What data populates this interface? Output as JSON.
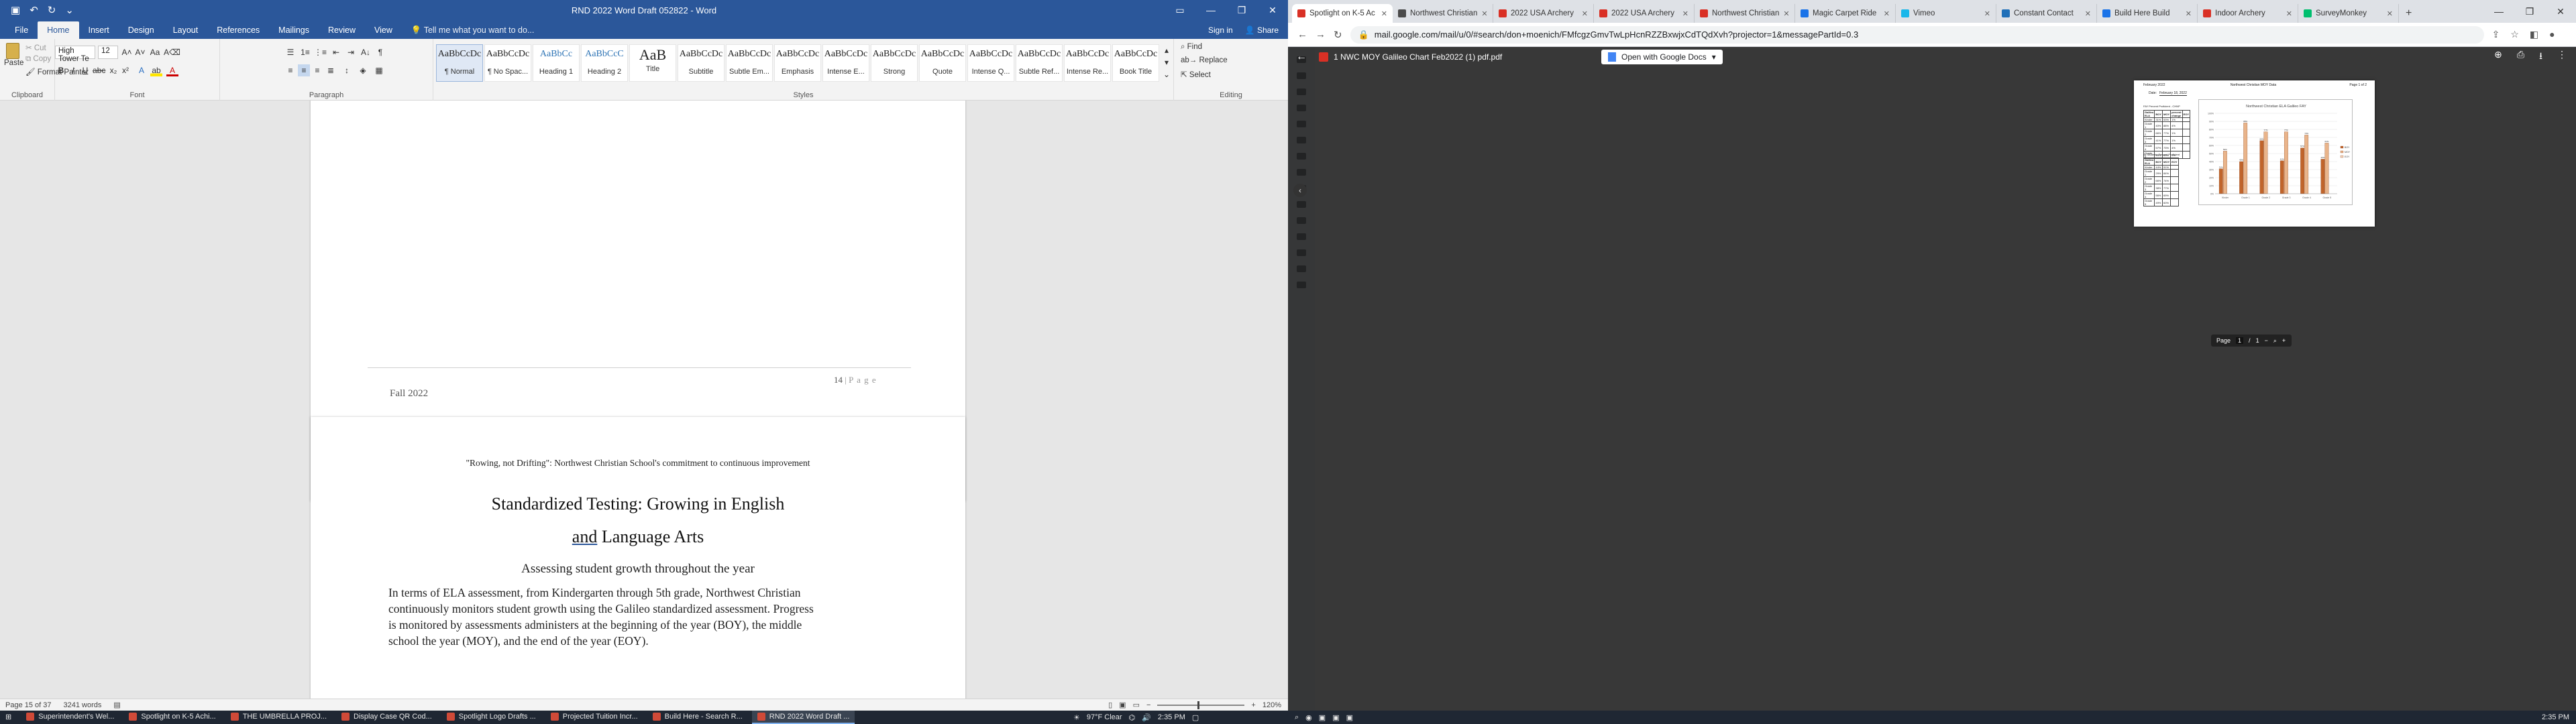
{
  "word": {
    "window_title": "RND 2022 Word Draft 052822 - Word",
    "sign_in": "Sign in",
    "share": "Share",
    "tabs": [
      "File",
      "Home",
      "Insert",
      "Design",
      "Layout",
      "References",
      "Mailings",
      "Review",
      "View"
    ],
    "active_tab": "Home",
    "tell_me": "Tell me what you want to do...",
    "ribbon": {
      "clipboard": {
        "label": "Clipboard",
        "paste": "Paste",
        "cut": "Cut",
        "copy": "Copy",
        "format_painter": "Format Painter"
      },
      "font": {
        "label": "Font",
        "font_name": "High Tower Te",
        "font_size": "12"
      },
      "paragraph": {
        "label": "Paragraph"
      },
      "styles": {
        "label": "Styles",
        "items": [
          {
            "preview": "AaBbCcDc",
            "name": "¶ Normal"
          },
          {
            "preview": "AaBbCcDc",
            "name": "¶ No Spac..."
          },
          {
            "preview": "AaBbCc",
            "name": "Heading 1"
          },
          {
            "preview": "AaBbCcC",
            "name": "Heading 2"
          },
          {
            "preview": "AaB",
            "name": "Title"
          },
          {
            "preview": "AaBbCcDc",
            "name": "Subtitle"
          },
          {
            "preview": "AaBbCcDc",
            "name": "Subtle Em..."
          },
          {
            "preview": "AaBbCcDc",
            "name": "Emphasis"
          },
          {
            "preview": "AaBbCcDc",
            "name": "Intense E..."
          },
          {
            "preview": "AaBbCcDc",
            "name": "Strong"
          },
          {
            "preview": "AaBbCcDc",
            "name": "Quote"
          },
          {
            "preview": "AaBbCcDc",
            "name": "Intense Q..."
          },
          {
            "preview": "AaBbCcDc",
            "name": "Subtle Ref..."
          },
          {
            "preview": "AaBbCcDc",
            "name": "Intense Re..."
          },
          {
            "preview": "AaBbCcDc",
            "name": "Book Title"
          }
        ]
      },
      "editing": {
        "label": "Editing",
        "find": "Find",
        "replace": "Replace",
        "select": "Select"
      }
    },
    "page1": {
      "footer_left": "Fall 2022",
      "page_number": "14",
      "page_word": "P a g e"
    },
    "page2": {
      "tagline": "\"Rowing, not Drifting\":  Northwest Christian School's commitment to continuous improvement",
      "title_line1": "Standardized Testing:  Growing in English",
      "title_line2_a": "and",
      "title_line2_b": " Language Arts",
      "subtitle": "Assessing student growth throughout the year",
      "body": [
        "In terms of ELA assessment, from Kindergarten through 5th grade, Northwest Christian",
        "continuously monitors student growth using the Galileo standardized assessment.  Progress",
        "is monitored by assessments administers at the beginning of the year (BOY), the middle",
        "school the year (MOY), and the end of the year (EOY)."
      ]
    },
    "status": {
      "page": "Page 15 of 37",
      "words": "3241 words",
      "zoom": "120%"
    }
  },
  "chrome": {
    "tabs": [
      {
        "title": "Spotlight on K-5 Ac",
        "active": true,
        "color": "#d93025"
      },
      {
        "title": "Northwest Christian",
        "active": false,
        "color": "#4a4a4a"
      },
      {
        "title": "2022 USA Archery",
        "active": false,
        "color": "#d93025"
      },
      {
        "title": "2022 USA Archery",
        "active": false,
        "color": "#d93025"
      },
      {
        "title": "Northwest Christian",
        "active": false,
        "color": "#d93025"
      },
      {
        "title": "Magic Carpet Ride",
        "active": false,
        "color": "#1a73e8"
      },
      {
        "title": "Vimeo",
        "active": false,
        "color": "#1ab7ea"
      },
      {
        "title": "Constant Contact",
        "active": false,
        "color": "#1f6fb8"
      },
      {
        "title": "Build Here Build",
        "active": false,
        "color": "#1a73e8"
      },
      {
        "title": "Indoor Archery",
        "active": false,
        "color": "#d93025"
      },
      {
        "title": "SurveyMonkey",
        "active": false,
        "color": "#00bf6f"
      }
    ],
    "url": "mail.google.com/mail/u/0/#search/don+moenich/FMfcgzGmvTwLpHcnRZZBxwjxCdTQdXvh?projector=1&messagePartId=0.3",
    "pdf": {
      "filename": "1 NWC MOY Galileo Chart Feb2022 (1) pdf.pdf",
      "open_with": "Open with Google Docs",
      "page_label": "Page",
      "page_current": "1",
      "page_total": "1",
      "header_left": "February 2022",
      "header_center": "Northwest Christian MOY Data",
      "header_right": "Page 1 of 2",
      "date_label": "Date:",
      "date_value": "February 18, 2022",
      "table1_title": "FAY Percent Proficient - CHNP",
      "table1_header": [
        "Galileo ELA",
        "BOY",
        "MOY",
        "percent change",
        "EOY"
      ],
      "table1_rows": [
        [
          "Kinder",
          "31%",
          "53%",
          "1%",
          ""
        ],
        [
          "Grade 1",
          "40%",
          "88%",
          "4%",
          ""
        ],
        [
          "Grade 2",
          "66%",
          "77%",
          "1%",
          ""
        ],
        [
          "Grade 3",
          "41%",
          "77%",
          "1%",
          ""
        ],
        [
          "Grade 4",
          "57%",
          "73%",
          "4%",
          ""
        ],
        [
          "Grade 5",
          "43%",
          "63%",
          "2%",
          ""
        ]
      ],
      "table2_title": "All Students Percent Proficient",
      "table2_header": [
        "Galileo ELA",
        "BOY",
        "MOY",
        "EOY"
      ],
      "table2_rows": [
        [
          "Kinder",
          "44%",
          "51%",
          ""
        ],
        [
          "Grade 1",
          "29%",
          "84%",
          ""
        ],
        [
          "Grade 2",
          "66%",
          "74%",
          ""
        ],
        [
          "Grade 3",
          "38%",
          "77%",
          ""
        ],
        [
          "Grade 4",
          "56%",
          "69%",
          ""
        ],
        [
          "Grade 5",
          "49%",
          "60%",
          ""
        ]
      ]
    }
  },
  "chart_data": {
    "type": "bar",
    "title": "Northwest Christian ELA Galileo FAY",
    "categories": [
      "Kinder",
      "Grade 1",
      "Grade 2",
      "Grade 3",
      "Grade 4",
      "Grade 5"
    ],
    "series": [
      {
        "name": "BOY",
        "values": [
          31,
          40,
          66,
          41,
          57,
          43
        ],
        "color": "#c0642b"
      },
      {
        "name": "MOY",
        "values": [
          53,
          88,
          77,
          77,
          73,
          63
        ],
        "color": "#e9b48a"
      },
      {
        "name": "EOY",
        "values": [
          0,
          0,
          0,
          0,
          0,
          0
        ],
        "color": "#f3d7bf"
      }
    ],
    "y_ticks": [
      "0%",
      "10%",
      "20%",
      "30%",
      "40%",
      "50%",
      "60%",
      "70%",
      "80%",
      "90%",
      "100%"
    ],
    "ylim": [
      0,
      100
    ],
    "grid": true,
    "legend_position": "right"
  },
  "taskbar": {
    "items": [
      {
        "label": "Superintendent's Wel...",
        "active": false
      },
      {
        "label": "Spotlight on K-5 Achi...",
        "active": false
      },
      {
        "label": "THE UMBRELLA PROJ...",
        "active": false
      },
      {
        "label": "Display Case QR Cod...",
        "active": false
      },
      {
        "label": "Spotlight Logo Drafts ...",
        "active": false
      },
      {
        "label": "Projected Tuition Incr...",
        "active": false
      },
      {
        "label": "Build Here - Search R...",
        "active": false
      },
      {
        "label": "RND 2022 Word Draft ...",
        "active": true
      }
    ],
    "weather": "97°F  Clear",
    "clock_left": "2:35 PM",
    "clock_right": "2:35 PM"
  }
}
